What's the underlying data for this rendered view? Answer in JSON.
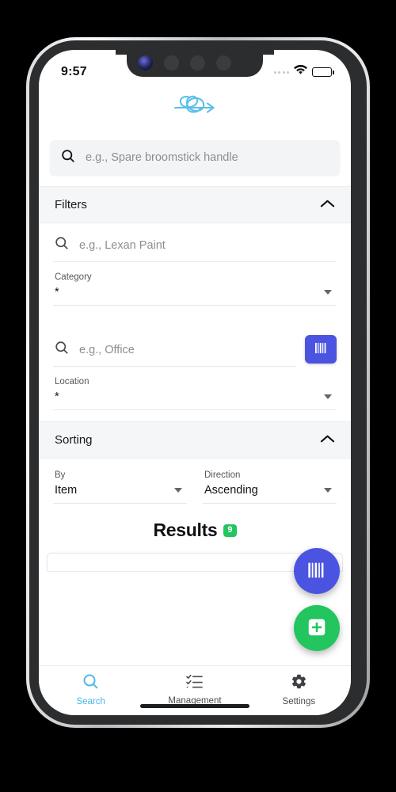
{
  "status_bar": {
    "time": "9:57",
    "signal_icon": "signal-dots-icon",
    "wifi_icon": "wifi-icon",
    "battery_icon": "battery-full-icon"
  },
  "header": {
    "logo_icon": "tangled-scribble-arrow-logo",
    "logo_color": "#5bc0e8"
  },
  "global_search": {
    "icon": "search-icon",
    "value": "",
    "placeholder": "e.g., Spare broomstick handle"
  },
  "filters": {
    "title": "Filters",
    "collapse_icon": "chevron-up-icon",
    "expanded": true,
    "item_search": {
      "icon": "search-icon",
      "value": "",
      "placeholder": "e.g., Lexan Paint"
    },
    "category": {
      "label": "Category",
      "value": "*",
      "caret_icon": "caret-down-icon"
    },
    "location_search": {
      "icon": "search-icon",
      "value": "",
      "placeholder": "e.g., Office",
      "scan_button_icon": "barcode-icon",
      "scan_button_color": "#4b54e0"
    },
    "location": {
      "label": "Location",
      "value": "*",
      "caret_icon": "caret-down-icon"
    }
  },
  "sorting": {
    "title": "Sorting",
    "collapse_icon": "chevron-up-icon",
    "expanded": true,
    "by": {
      "label": "By",
      "value": "Item",
      "caret_icon": "caret-down-icon"
    },
    "direction": {
      "label": "Direction",
      "value": "Ascending",
      "caret_icon": "caret-down-icon"
    }
  },
  "results": {
    "title": "Results",
    "count": "9",
    "count_color": "#22c55e"
  },
  "fab": {
    "scan_icon": "barcode-icon",
    "scan_color": "#4b54e0",
    "add_icon": "add-box-icon",
    "add_color": "#22c55e"
  },
  "bottom_nav": {
    "active_color": "#4db8e8",
    "items": [
      {
        "label": "Search",
        "icon": "search-icon",
        "active": true
      },
      {
        "label": "Management",
        "icon": "checklist-icon",
        "active": false
      },
      {
        "label": "Settings",
        "icon": "gear-icon",
        "active": false
      }
    ]
  }
}
